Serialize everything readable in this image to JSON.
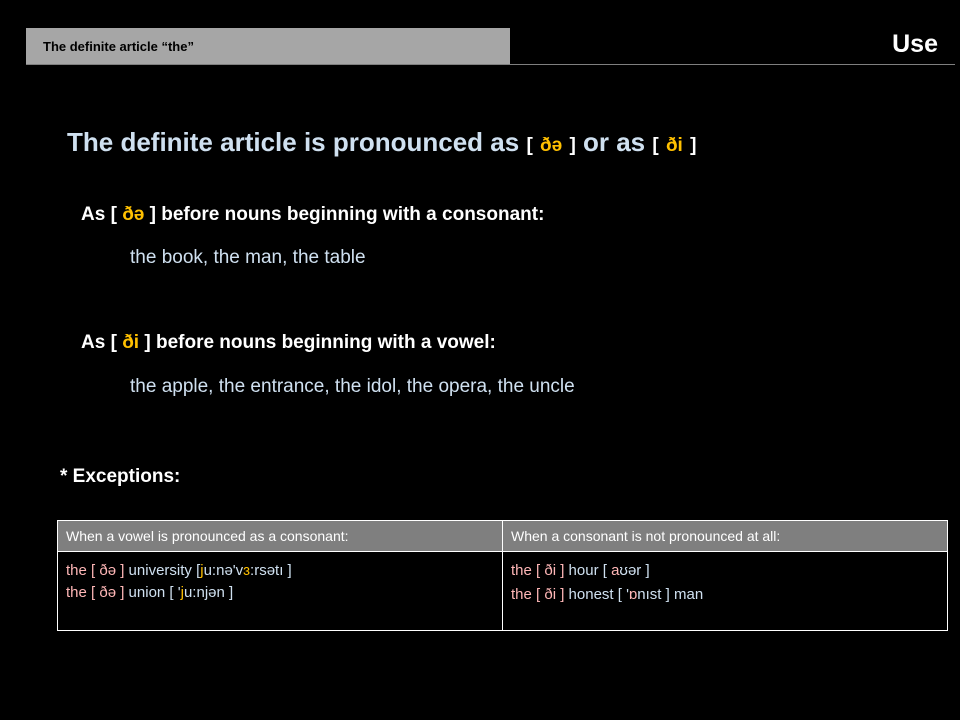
{
  "header": {
    "title": "The definite article “the”",
    "section": "Use"
  },
  "heading": {
    "main": "The definite article is pronounced as",
    "or_as": "or as",
    "ipa1": "ðə",
    "ipa2": "ði"
  },
  "rule1": {
    "prefix": "As [",
    "ipa": "ðə",
    "suffix": "] before nouns beginning with a consonant:",
    "examples": "the book, the man, the table"
  },
  "rule2": {
    "prefix": "As [",
    "ipa": "ði",
    "suffix": "] before nouns beginning with a vowel:",
    "examples": "the apple, the entrance, the idol, the opera, the uncle"
  },
  "exceptions": {
    "title": "* Exceptions:",
    "col1_header": "When a vowel is pronounced as a consonant:",
    "col2_header": "When a consonant is not pronounced at all:",
    "col1": {
      "line1_article": "the [ ðə ]",
      "line1_word": "university [",
      "line1_j": "j",
      "line1_ipa_a": "u:nə'v",
      "line1_ipa_b": "ɜ",
      "line1_ipa_c": ":rsətı ]",
      "line2_article": "the [ ðə ]",
      "line2_word": "union  [ '",
      "line2_j": "j",
      "line2_ipa": "u:njən ]"
    },
    "col2": {
      "line1_article": "the [ ði ]",
      "line1_word": "hour [",
      "line1_a": "a",
      "line1_rest": "ʊər ]",
      "line2_article": "the [ ði ]",
      "line2_word": "honest [ '",
      "line2_o": "ɒ",
      "line2_rest": "nıst ] man"
    }
  },
  "colors": {
    "background": "#000000",
    "header_bar": "#a6a6a6",
    "heading_text": "#cfe0f0",
    "ipa_highlight": "#ffc000",
    "article_pink": "#ffb7b7"
  }
}
